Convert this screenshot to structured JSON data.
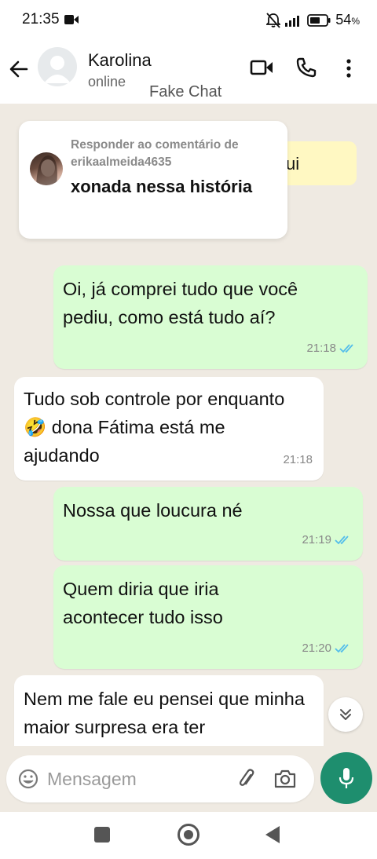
{
  "status_bar": {
    "time": "21:35",
    "battery": "54",
    "battery_unit": "%"
  },
  "header": {
    "contact_name": "Karolina",
    "contact_status": "online",
    "watermark": "Fake Chat"
  },
  "reply_overlay": {
    "title": "Responder ao comentário de erikaalmeida4635",
    "body": "xonada nessa história",
    "partial_text": "ui"
  },
  "messages": [
    {
      "direction": "out",
      "text": "Oi, já comprei tudo que você pediu, como está tudo aí?",
      "time": "21:18",
      "status": "read"
    },
    {
      "direction": "in",
      "text": "Tudo sob controle por enquanto 🤣 dona Fátima está me ajudando",
      "time": "21:18"
    },
    {
      "direction": "out",
      "text": "Nossa que loucura né",
      "time": "21:19",
      "status": "read"
    },
    {
      "direction": "out",
      "text": "Quem diria que iria acontecer tudo isso",
      "time": "21:20",
      "status": "read"
    },
    {
      "direction": "in",
      "text": "Nem me fale eu pensei que minha maior surpresa era ter",
      "time": ""
    }
  ],
  "input": {
    "placeholder": "Mensagem"
  },
  "colors": {
    "chat_bg": "#efeae2",
    "outgoing_bubble": "#d9fdd3",
    "incoming_bubble": "#ffffff",
    "accent": "#1e8e6e",
    "read_ticks": "#53bdeb"
  },
  "icons": [
    "back-arrow-icon",
    "video-call-icon",
    "phone-icon",
    "more-vert-icon",
    "emoji-icon",
    "paperclip-icon",
    "camera-icon",
    "mic-icon",
    "chevron-double-down-icon"
  ]
}
